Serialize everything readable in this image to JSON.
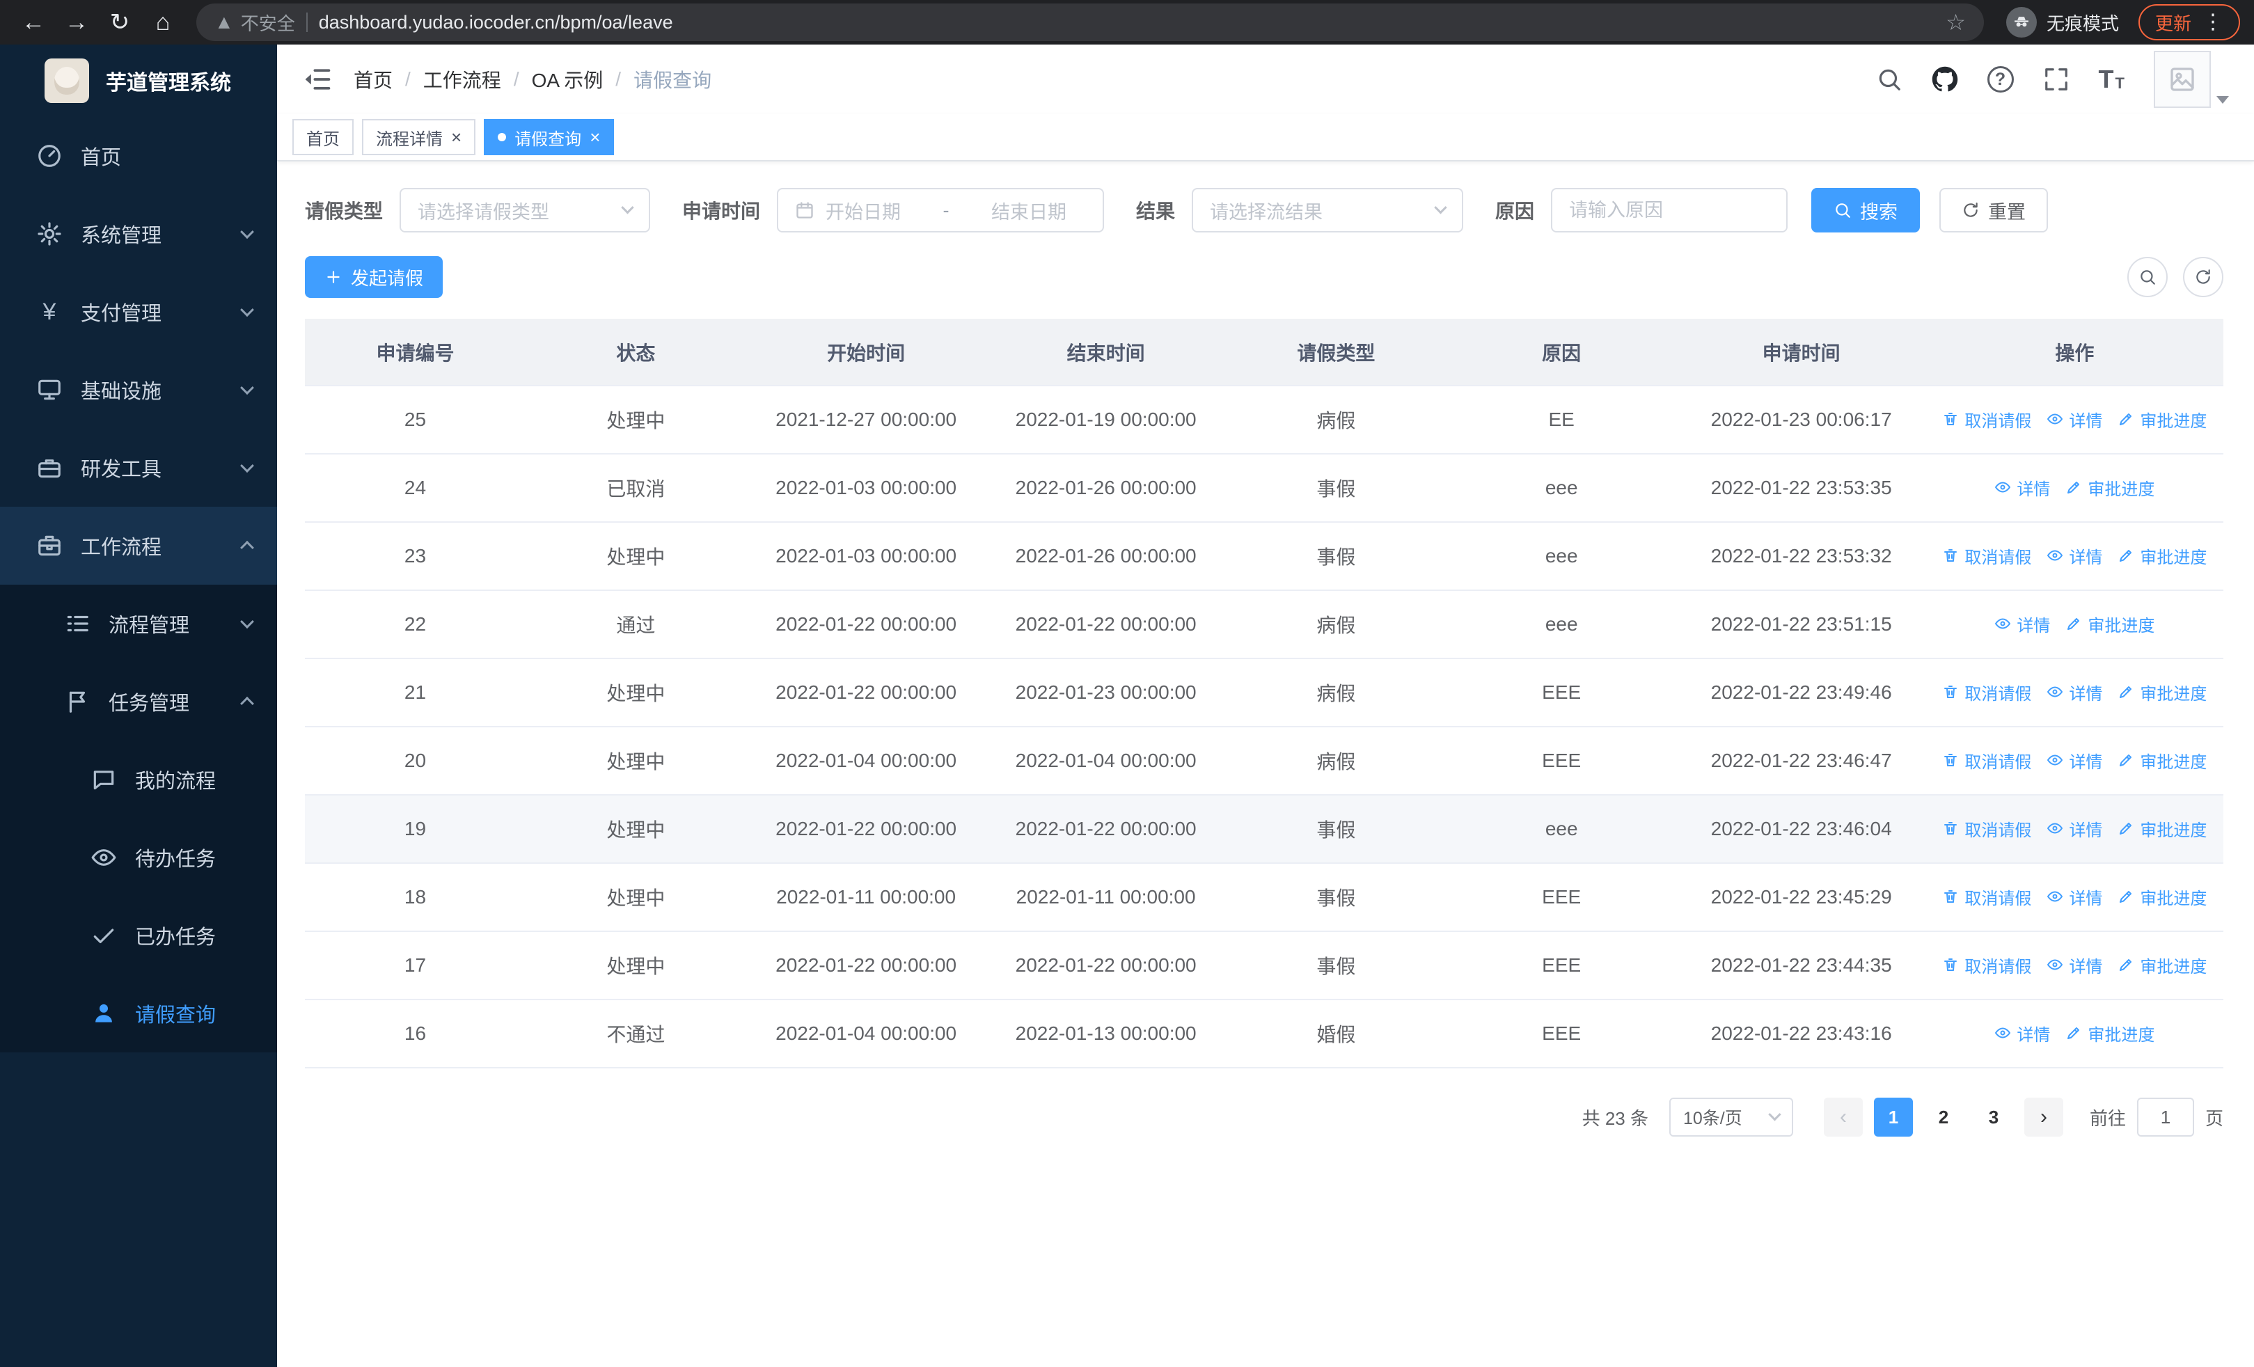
{
  "colors": {
    "primary": "#409eff",
    "sidebar_bg": "#0e2338",
    "submenu_bg": "#0a1a2b",
    "update_chip": "#f8653c",
    "header_row_bg": "#f0f2f5"
  },
  "browser": {
    "security_warning": "不安全",
    "url": "dashboard.yudao.iocoder.cn/bpm/oa/leave",
    "incognito_label": "无痕模式",
    "update_label": "更新",
    "nav_icons": [
      "back-icon",
      "forward-icon",
      "refresh-icon",
      "home-icon",
      "star-icon",
      "incognito-icon",
      "menu-dots-icon"
    ]
  },
  "app": {
    "title": "芋道管理系统"
  },
  "sidebar": {
    "items": [
      {
        "label": "首页",
        "icon": "dashboard-icon"
      },
      {
        "label": "系统管理",
        "icon": "gear-icon"
      },
      {
        "label": "支付管理",
        "icon": "yen-icon"
      },
      {
        "label": "基础设施",
        "icon": "monitor-icon"
      },
      {
        "label": "研发工具",
        "icon": "toolbox-icon"
      },
      {
        "label": "工作流程",
        "icon": "briefcase-icon"
      }
    ],
    "workflow_children": [
      {
        "label": "流程管理",
        "icon": "ordered-list-icon"
      },
      {
        "label": "任务管理",
        "icon": "flag-icon"
      }
    ],
    "task_children": [
      {
        "label": "我的流程",
        "icon": "chat-icon"
      },
      {
        "label": "待办任务",
        "icon": "eye-icon"
      },
      {
        "label": "已办任务",
        "icon": "check-icon"
      },
      {
        "label": "请假查询",
        "icon": "user-icon"
      }
    ]
  },
  "header": {
    "breadcrumb": [
      "首页",
      "工作流程",
      "OA 示例",
      "请假查询"
    ],
    "icons": [
      "search-icon",
      "github-icon",
      "help-icon",
      "fullscreen-icon",
      "font-size-icon",
      "avatar"
    ]
  },
  "tabs": [
    {
      "label": "首页",
      "closable": false,
      "active": false
    },
    {
      "label": "流程详情",
      "closable": true,
      "active": false
    },
    {
      "label": "请假查询",
      "closable": true,
      "active": true
    }
  ],
  "filters": {
    "leave_type_label": "请假类型",
    "leave_type_placeholder": "请选择请假类型",
    "apply_time_label": "申请时间",
    "start_date_placeholder": "开始日期",
    "range_separator": "-",
    "end_date_placeholder": "结束日期",
    "result_label": "结果",
    "result_placeholder": "请选择流结果",
    "reason_label": "原因",
    "reason_placeholder": "请输入原因",
    "search_label": "搜索",
    "reset_label": "重置"
  },
  "toolbar": {
    "create_label": "发起请假"
  },
  "table": {
    "columns": [
      "申请编号",
      "状态",
      "开始时间",
      "结束时间",
      "请假类型",
      "原因",
      "申请时间",
      "操作"
    ],
    "action_defs": {
      "cancel": {
        "label": "取消请假",
        "icon": "delete-icon"
      },
      "detail": {
        "label": "详情",
        "icon": "view-icon"
      },
      "progress": {
        "label": "审批进度",
        "icon": "edit-icon"
      }
    },
    "rows": [
      {
        "id": "25",
        "status": "处理中",
        "start": "2021-12-27 00:00:00",
        "end": "2022-01-19 00:00:00",
        "type": "病假",
        "reason": "EE",
        "applied": "2022-01-23 00:06:17",
        "actions": [
          "cancel",
          "detail",
          "progress"
        ],
        "highlighted": false
      },
      {
        "id": "24",
        "status": "已取消",
        "start": "2022-01-03 00:00:00",
        "end": "2022-01-26 00:00:00",
        "type": "事假",
        "reason": "eee",
        "applied": "2022-01-22 23:53:35",
        "actions": [
          "detail",
          "progress"
        ],
        "highlighted": false
      },
      {
        "id": "23",
        "status": "处理中",
        "start": "2022-01-03 00:00:00",
        "end": "2022-01-26 00:00:00",
        "type": "事假",
        "reason": "eee",
        "applied": "2022-01-22 23:53:32",
        "actions": [
          "cancel",
          "detail",
          "progress"
        ],
        "highlighted": false
      },
      {
        "id": "22",
        "status": "通过",
        "start": "2022-01-22 00:00:00",
        "end": "2022-01-22 00:00:00",
        "type": "病假",
        "reason": "eee",
        "applied": "2022-01-22 23:51:15",
        "actions": [
          "detail",
          "progress"
        ],
        "highlighted": false
      },
      {
        "id": "21",
        "status": "处理中",
        "start": "2022-01-22 00:00:00",
        "end": "2022-01-23 00:00:00",
        "type": "病假",
        "reason": "EEE",
        "applied": "2022-01-22 23:49:46",
        "actions": [
          "cancel",
          "detail",
          "progress"
        ],
        "highlighted": false
      },
      {
        "id": "20",
        "status": "处理中",
        "start": "2022-01-04 00:00:00",
        "end": "2022-01-04 00:00:00",
        "type": "病假",
        "reason": "EEE",
        "applied": "2022-01-22 23:46:47",
        "actions": [
          "cancel",
          "detail",
          "progress"
        ],
        "highlighted": false
      },
      {
        "id": "19",
        "status": "处理中",
        "start": "2022-01-22 00:00:00",
        "end": "2022-01-22 00:00:00",
        "type": "事假",
        "reason": "eee",
        "applied": "2022-01-22 23:46:04",
        "actions": [
          "cancel",
          "detail",
          "progress"
        ],
        "highlighted": true
      },
      {
        "id": "18",
        "status": "处理中",
        "start": "2022-01-11 00:00:00",
        "end": "2022-01-11 00:00:00",
        "type": "事假",
        "reason": "EEE",
        "applied": "2022-01-22 23:45:29",
        "actions": [
          "cancel",
          "detail",
          "progress"
        ],
        "highlighted": false
      },
      {
        "id": "17",
        "status": "处理中",
        "start": "2022-01-22 00:00:00",
        "end": "2022-01-22 00:00:00",
        "type": "事假",
        "reason": "EEE",
        "applied": "2022-01-22 23:44:35",
        "actions": [
          "cancel",
          "detail",
          "progress"
        ],
        "highlighted": false
      },
      {
        "id": "16",
        "status": "不通过",
        "start": "2022-01-04 00:00:00",
        "end": "2022-01-13 00:00:00",
        "type": "婚假",
        "reason": "EEE",
        "applied": "2022-01-22 23:43:16",
        "actions": [
          "detail",
          "progress"
        ],
        "highlighted": false
      }
    ]
  },
  "pagination": {
    "total_text": "共 23 条",
    "page_size_text": "10条/页",
    "pages": [
      "1",
      "2",
      "3"
    ],
    "active_page": "1",
    "prev_icon": "chevron-left-icon",
    "next_icon": "chevron-right-icon",
    "goto_label": "前往",
    "goto_value": "1",
    "page_suffix": "页"
  }
}
